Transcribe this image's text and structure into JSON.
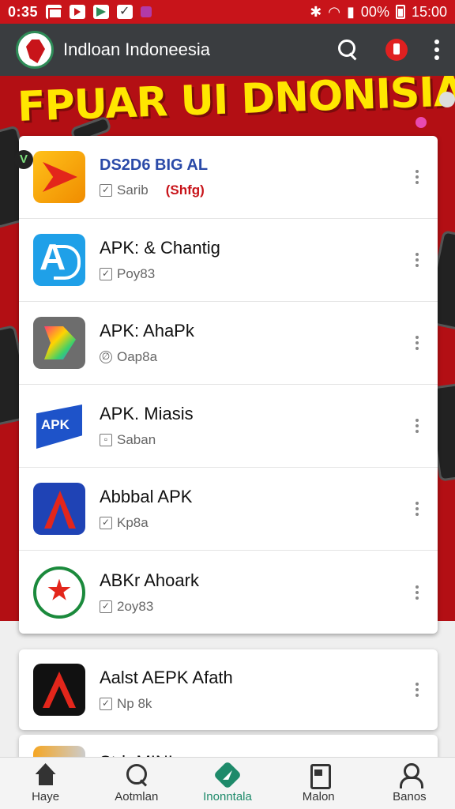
{
  "status_bar": {
    "time": "0:35",
    "battery_text": "00%",
    "clock_right": "15:00"
  },
  "app_bar": {
    "title": "Indloan Indoneesia"
  },
  "hero": {
    "title": "FPUAR UI DNONISIA"
  },
  "apps": [
    {
      "name": "DS2D6 BIG AL",
      "sub": "Sarib",
      "tag": "(Shfg)",
      "icon": "orange-play-icon",
      "badge": "V"
    },
    {
      "name": "APK: & Chantig",
      "sub": "Poy83",
      "icon": "blue-apk-icon"
    },
    {
      "name": "APK: AhaPk",
      "sub": "Oap8a",
      "icon": "gradient-app-icon"
    },
    {
      "name": "APK. Miasis",
      "sub": "Saban",
      "icon": "apk-flag-icon"
    },
    {
      "name": "Abbbal APK",
      "sub": "Kp8a",
      "icon": "navy-a-icon"
    },
    {
      "name": "ABKr Ahoark",
      "sub": "2oy83",
      "icon": "green-star-icon"
    }
  ],
  "extra_card": {
    "name": "Aalst AEPK Afath",
    "sub": "Np 8k",
    "icon": "black-a-icon"
  },
  "peek_card": {
    "name": "Stdr MINI"
  },
  "bottom_nav": [
    {
      "label": "Haye",
      "icon": "home-icon"
    },
    {
      "label": "Aotmlan",
      "icon": "compass-icon"
    },
    {
      "label": "Inonntala",
      "icon": "store-icon",
      "active": true
    },
    {
      "label": "Malon",
      "icon": "doc-icon"
    },
    {
      "label": "Banos",
      "icon": "user-icon"
    }
  ],
  "colors": {
    "status_bar": "#c8141a",
    "app_bar": "#3a3d40",
    "hero": "#b30f14",
    "hero_title": "#ffe600",
    "active_nav": "#1e8a6a"
  }
}
